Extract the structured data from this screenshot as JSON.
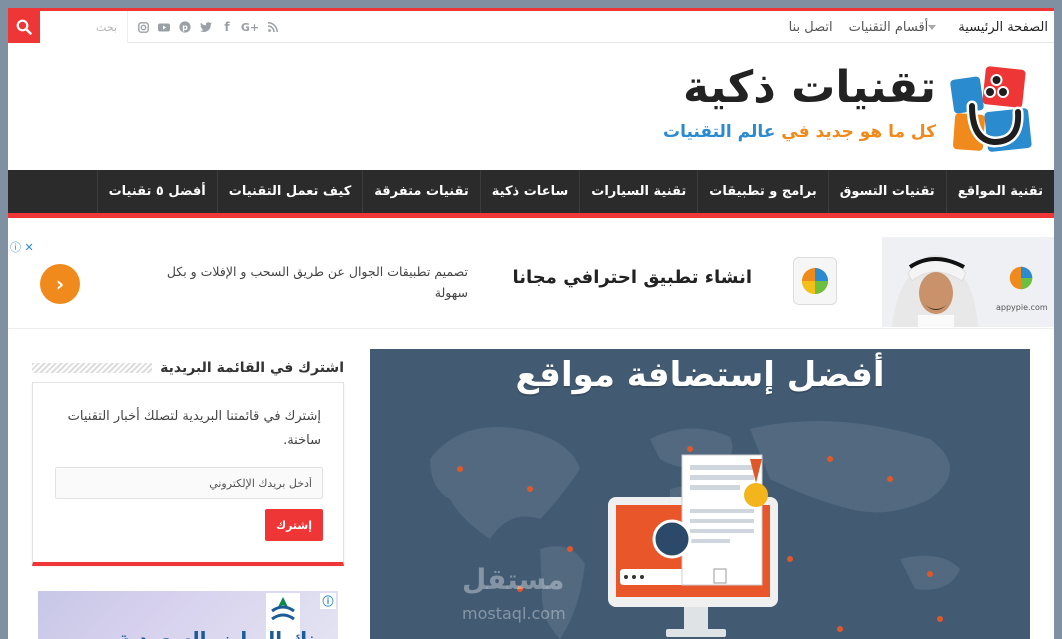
{
  "topbar": {
    "search_placeholder": "بحث",
    "nav": [
      {
        "label": "الصفحة الرئيسية"
      },
      {
        "label": "أقسام التقنيات"
      },
      {
        "label": "اتصل بنا"
      }
    ],
    "social_icons": [
      "rss-icon",
      "google-plus-icon",
      "facebook-icon",
      "twitter-icon",
      "pinterest-icon",
      "youtube-icon",
      "instagram-icon"
    ]
  },
  "logo": {
    "title": "تقنيات ذكية",
    "tagline_part1": "كل ما هو جديد في ",
    "tagline_part2": "عالم التقنيات"
  },
  "mainnav": [
    {
      "label": "تقنية المواقع"
    },
    {
      "label": "تقنيات التسوق"
    },
    {
      "label": "برامج و تطبيقات"
    },
    {
      "label": "تقنية السيارات"
    },
    {
      "label": "ساعات ذكية"
    },
    {
      "label": "تقنيات متفرقة"
    },
    {
      "label": "كيف تعمل التقنيات"
    },
    {
      "label": "أفضل ٥ تقنيات"
    }
  ],
  "ad": {
    "title": "انشاء تطبيق احترافي مجانا",
    "description": "تصميم تطبيقات الجوال عن طريق السحب و الإفلات و بكل سهولة",
    "brand": "appypie.com"
  },
  "featured": {
    "title": "أفضل إستضافة مواقع",
    "watermark": "مستقل",
    "watermark_url": "mostaql.com"
  },
  "sidebar": {
    "widget_title": "اشترك في القائمة البريدية",
    "text": "إشترك في قائمتنا البريدية لتصلك أخبار التقنيات ساخنة.",
    "email_placeholder": "أدخل بريدك الإلكتروني",
    "button": "إشترك"
  },
  "ad2": {
    "text": "بنك الرياض السعودية"
  },
  "colors": {
    "accent": "#ef3636",
    "orange": "#f08a1c",
    "blue": "#2a8bcf",
    "nav_bg": "#2b2b2b"
  }
}
